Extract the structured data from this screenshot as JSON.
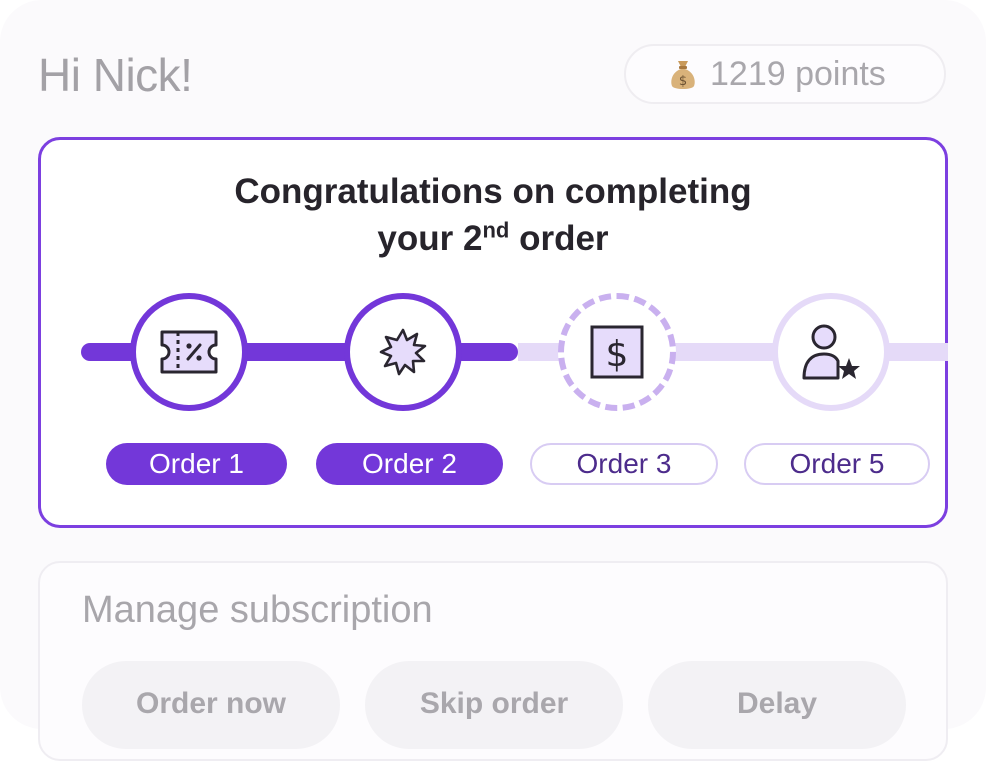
{
  "header": {
    "greeting": "Hi Nick!",
    "points_text": "1219 points",
    "points_icon": "money-bag-icon"
  },
  "progress": {
    "headline_line1": "Congratulations on completing",
    "headline_line2_before": "your 2",
    "headline_line2_sup": "nd",
    "headline_line2_after": " order",
    "steps": [
      {
        "label": "Order 1",
        "status": "done",
        "icon": "discount-ticket-icon"
      },
      {
        "label": "Order 2",
        "status": "done",
        "icon": "burst-badge-icon"
      },
      {
        "label": "Order 3",
        "status": "current",
        "icon": "dollar-bill-icon"
      },
      {
        "label": "Order 5",
        "status": "future",
        "icon": "user-star-icon"
      }
    ],
    "colors": {
      "accent": "#7337d9",
      "accent_light": "#e5daf8",
      "icon_fill": "#e6dcfb",
      "icon_stroke": "#2a2630"
    }
  },
  "manage": {
    "title": "Manage subscription",
    "buttons": [
      "Order now",
      "Skip order",
      "Delay"
    ]
  }
}
